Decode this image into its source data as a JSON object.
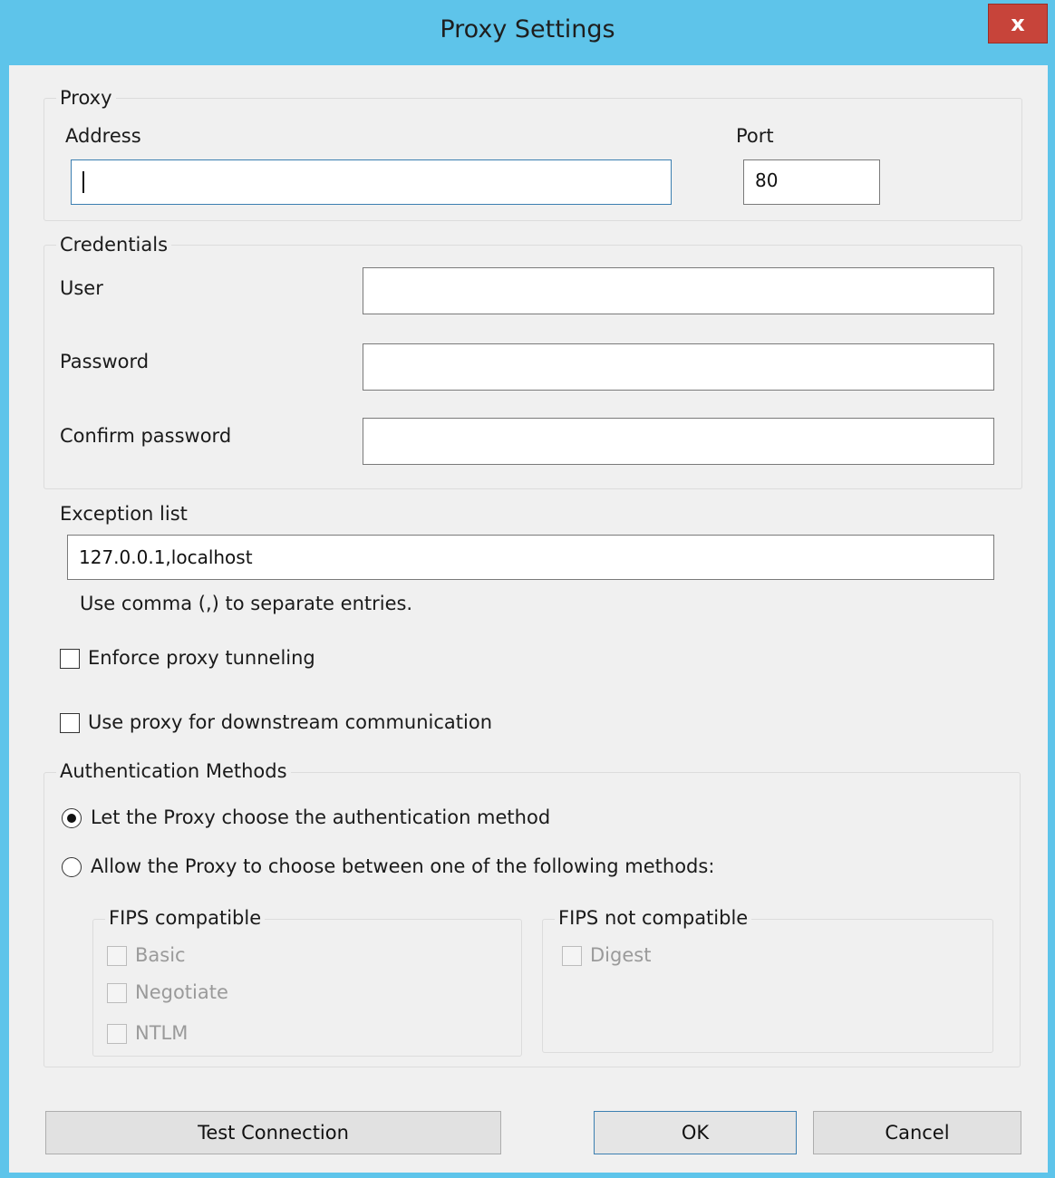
{
  "window": {
    "title": "Proxy Settings",
    "close_glyph": "x"
  },
  "proxy": {
    "group_label": "Proxy",
    "address_label": "Address",
    "address_value": "",
    "port_label": "Port",
    "port_value": "80"
  },
  "credentials": {
    "group_label": "Credentials",
    "user_label": "User",
    "user_value": "",
    "password_label": "Password",
    "password_value": "",
    "confirm_label": "Confirm password",
    "confirm_value": ""
  },
  "exceptions": {
    "label": "Exception list",
    "value": "127.0.0.1,localhost",
    "hint": "Use comma (,) to separate entries."
  },
  "options": {
    "enforce_tunneling_label": "Enforce proxy tunneling",
    "enforce_tunneling_checked": false,
    "downstream_label": "Use proxy for downstream communication",
    "downstream_checked": false
  },
  "auth": {
    "group_label": "Authentication Methods",
    "radio_auto_label": "Let the Proxy choose the authentication method",
    "radio_auto_checked": true,
    "radio_select_label": "Allow the Proxy to choose between one of the following methods:",
    "radio_select_checked": false,
    "fips_group_label": "FIPS compatible",
    "fips_methods": [
      "Basic",
      "Negotiate",
      "NTLM"
    ],
    "nonfips_group_label": "FIPS not compatible",
    "nonfips_methods": [
      "Digest"
    ]
  },
  "buttons": {
    "test_connection": "Test Connection",
    "ok": "OK",
    "cancel": "Cancel"
  }
}
